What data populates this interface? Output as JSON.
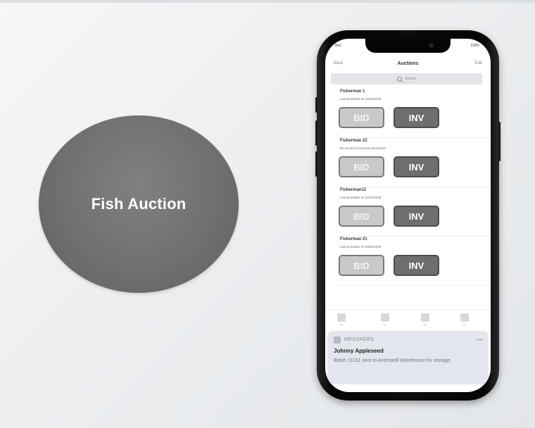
{
  "left": {
    "title": "Fish Auction"
  },
  "phone": {
    "status": {
      "carrier": "Ben",
      "time": "100%"
    },
    "nav": {
      "back": "Back",
      "title": "Auctions",
      "edit": "Edit"
    },
    "search": {
      "placeholder": "Search"
    },
    "auctions": [
      {
        "name": "Fisherman 1",
        "subtitle": "Last purchase on 10/05/2018",
        "bid_label": "BID",
        "inv_label": "INV"
      },
      {
        "name": "Fisherman 22",
        "subtitle": "No record of previous purchases",
        "bid_label": "BID",
        "inv_label": "INV"
      },
      {
        "name": "Fisherman12",
        "subtitle": "Last purchase on 10/21/2018",
        "bid_label": "BID",
        "inv_label": "INV"
      },
      {
        "name": "Fisherman 21",
        "subtitle": "Last purchase on 09/05/2018",
        "bid_label": "BID",
        "inv_label": "INV"
      }
    ],
    "tabs": [
      {
        "label": "Item"
      },
      {
        "label": "Item"
      },
      {
        "label": "Item"
      },
      {
        "label": "Item"
      }
    ],
    "notification": {
      "app": "MESSAGES",
      "time": "now",
      "title": "Johnny Appleseed",
      "body": "Batch 11011 sent to Antersedl Warehouse for storage."
    }
  },
  "colors": {
    "circle": "#707070",
    "bid_button": "#c9c9c9",
    "inv_button": "#6e6e6e",
    "notification_bg": "#e3e6ec"
  }
}
